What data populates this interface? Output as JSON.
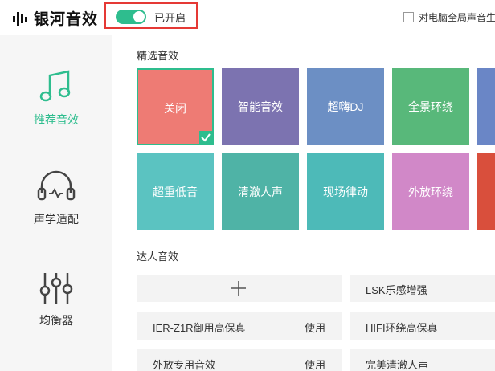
{
  "app": {
    "name": "银河音效"
  },
  "header": {
    "toggle_label": "已开启",
    "global_checkbox_label": "对电脑全局声音生效"
  },
  "sidebar": {
    "items": [
      {
        "label": "推荐音效",
        "icon": "music-note-icon",
        "active": true
      },
      {
        "label": "声学适配",
        "icon": "headphones-icon",
        "active": false
      },
      {
        "label": "均衡器",
        "icon": "equalizer-icon",
        "active": false
      }
    ]
  },
  "featured": {
    "title": "精选音效",
    "tiles": [
      {
        "label": "关闭",
        "color": "#ee7b74",
        "selected": true
      },
      {
        "label": "智能音效",
        "color": "#7c73b0",
        "selected": false
      },
      {
        "label": "超嗨DJ",
        "color": "#6c8fc4",
        "selected": false
      },
      {
        "label": "全景环绕",
        "color": "#58b87a",
        "selected": false
      },
      {
        "label": "",
        "color": "#6a86c6",
        "selected": false
      },
      {
        "label": "超重低音",
        "color": "#5bc3c1",
        "selected": false
      },
      {
        "label": "清澈人声",
        "color": "#4fb3a6",
        "selected": false
      },
      {
        "label": "现场律动",
        "color": "#4dbab8",
        "selected": false
      },
      {
        "label": "外放环绕",
        "color": "#d188c8",
        "selected": false
      },
      {
        "label": "",
        "color": "#d94f3c",
        "selected": false
      }
    ]
  },
  "expert": {
    "title": "达人音效",
    "add_icon": "plus-icon",
    "rows": [
      {
        "name": "LSK乐感增强",
        "action": ""
      },
      {
        "name": "IER-Z1R御用高保真",
        "action": "使用"
      },
      {
        "name": "HIFI环绕高保真",
        "action": ""
      },
      {
        "name": "外放专用音效",
        "action": "使用"
      },
      {
        "name": "完美清澈人声",
        "action": ""
      }
    ]
  },
  "colors": {
    "accent": "#2ebd8e",
    "highlight_frame": "#e53935"
  }
}
